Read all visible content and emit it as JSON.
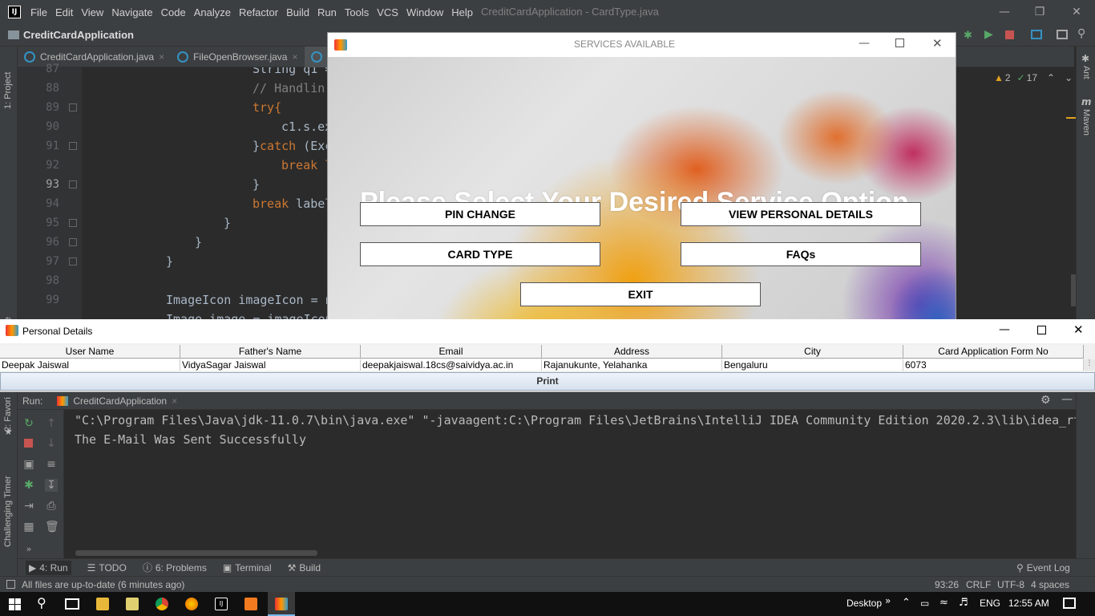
{
  "menubar": {
    "items": [
      "File",
      "Edit",
      "View",
      "Navigate",
      "Code",
      "Analyze",
      "Refactor",
      "Build",
      "Run",
      "Tools",
      "VCS",
      "Window",
      "Help"
    ],
    "title": "CreditCardApplication - CardType.java"
  },
  "navbar": {
    "project": "CreditCardApplication"
  },
  "tabs": [
    "CreditCardApplication.java",
    "FileOpenBrowser.java"
  ],
  "sidebar": {
    "project": "1: Project",
    "structure": "ture",
    "favorites": "2: Favori",
    "timer": "Challenging Timer"
  },
  "rightbar": {
    "ant": "Ant",
    "maven": "Maven"
  },
  "inspections": {
    "warnings": "2",
    "weak": "17"
  },
  "editor": {
    "line_numbers": [
      "87",
      "88",
      "89",
      "90",
      "91",
      "92",
      "93",
      "94",
      "95",
      "96",
      "97",
      "98",
      "99"
    ],
    "lines": {
      "l87": "String q1 =",
      "l88": "// Handlin",
      "l89": "try{",
      "l90": "c1.s.ex",
      "l91a": "}",
      "l91b": "catch",
      "l91c": " (Exc",
      "l92": "break l",
      "l93": "}",
      "l94a": "break",
      "l94b": " label",
      "l95": "}",
      "l96": "}",
      "l97": "}",
      "l99": "ImageIcon imageIcon = n",
      "l100": "Image image = imageIcon"
    }
  },
  "services_window": {
    "title": "SERVICES AVAILABLE",
    "heading": "Please Select Your Desired Service Option",
    "buttons": {
      "pin_change": "PIN CHANGE",
      "view_details": "VIEW PERSONAL DETAILS",
      "card_type": "CARD TYPE",
      "faqs": "FAQs",
      "exit": "EXIT"
    }
  },
  "personal_details": {
    "title": "Personal Details",
    "columns": [
      "User Name",
      "Father's Name",
      "Email",
      "Address",
      "City",
      "Card Application Form No"
    ],
    "row": [
      "Deepak Jaiswal",
      "VidyaSagar Jaiswal",
      "deepakjaiswal.18cs@saividya.ac.in",
      "Rajanukunte, Yelahanka",
      "Bengaluru",
      "6073"
    ],
    "print_label": "Print"
  },
  "run_panel": {
    "label": "Run:",
    "config": "CreditCardApplication",
    "console": [
      "\"C:\\Program Files\\Java\\jdk-11.0.7\\bin\\java.exe\" \"-javaagent:C:\\Program Files\\JetBrains\\IntelliJ IDEA Community Edition 2020.2.3\\lib\\idea_rt",
      "The E-Mail Was Sent Successfully"
    ]
  },
  "tool_windows": {
    "run": "4: Run",
    "todo": "TODO",
    "problems": "6: Problems",
    "terminal": "Terminal",
    "build": "Build",
    "event_log": "Event Log"
  },
  "status": {
    "message": "All files are up-to-date (6 minutes ago)",
    "position": "93:26",
    "line_sep": "CRLF",
    "encoding": "UTF-8",
    "indent": "4 spaces"
  },
  "taskbar": {
    "desktop": "Desktop",
    "chevron": "»",
    "lang": "ENG",
    "time": "12:55 AM"
  },
  "colors": {
    "accent": "#3592c4",
    "keyword": "#cc7832",
    "background": "#2b2b2b"
  }
}
